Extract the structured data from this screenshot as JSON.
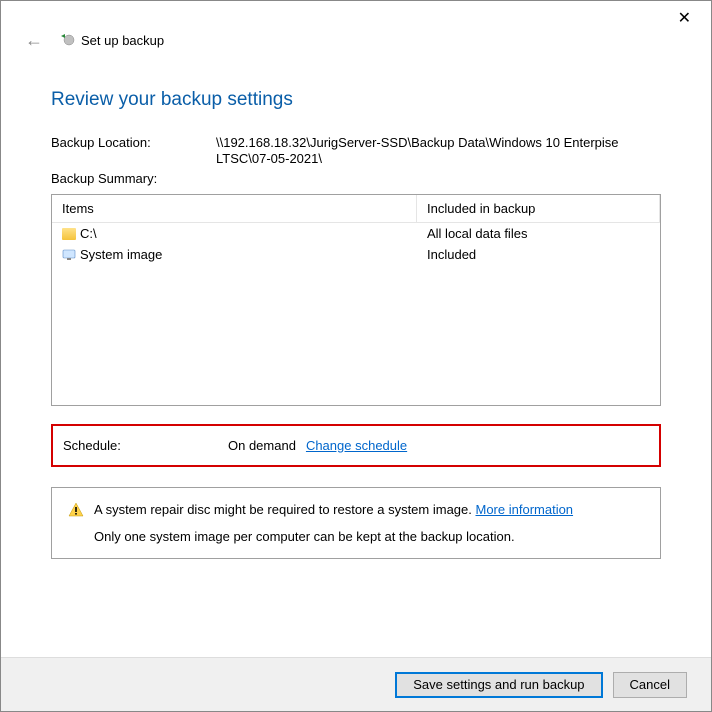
{
  "header": {
    "app_title": "Set up backup"
  },
  "page_title": "Review your backup settings",
  "location": {
    "label": "Backup Location:",
    "value": "\\\\192.168.18.32\\JurigServer-SSD\\Backup Data\\Windows 10 Enterpise LTSC\\07-05-2021\\"
  },
  "summary_label": "Backup Summary:",
  "table": {
    "col_items": "Items",
    "col_included": "Included in backup",
    "rows": [
      {
        "name": "C:\\",
        "included": "All local data files",
        "icon": "folder"
      },
      {
        "name": "System image",
        "included": "Included",
        "icon": "monitor"
      }
    ]
  },
  "schedule": {
    "label": "Schedule:",
    "value": "On demand",
    "link": "Change schedule"
  },
  "warning": {
    "line1_pre": "A system repair disc might be required to restore a system image. ",
    "line1_link": "More information",
    "line2": "Only one system image per computer can be kept at the backup location."
  },
  "footer": {
    "primary": "Save settings and run backup",
    "cancel": "Cancel"
  }
}
